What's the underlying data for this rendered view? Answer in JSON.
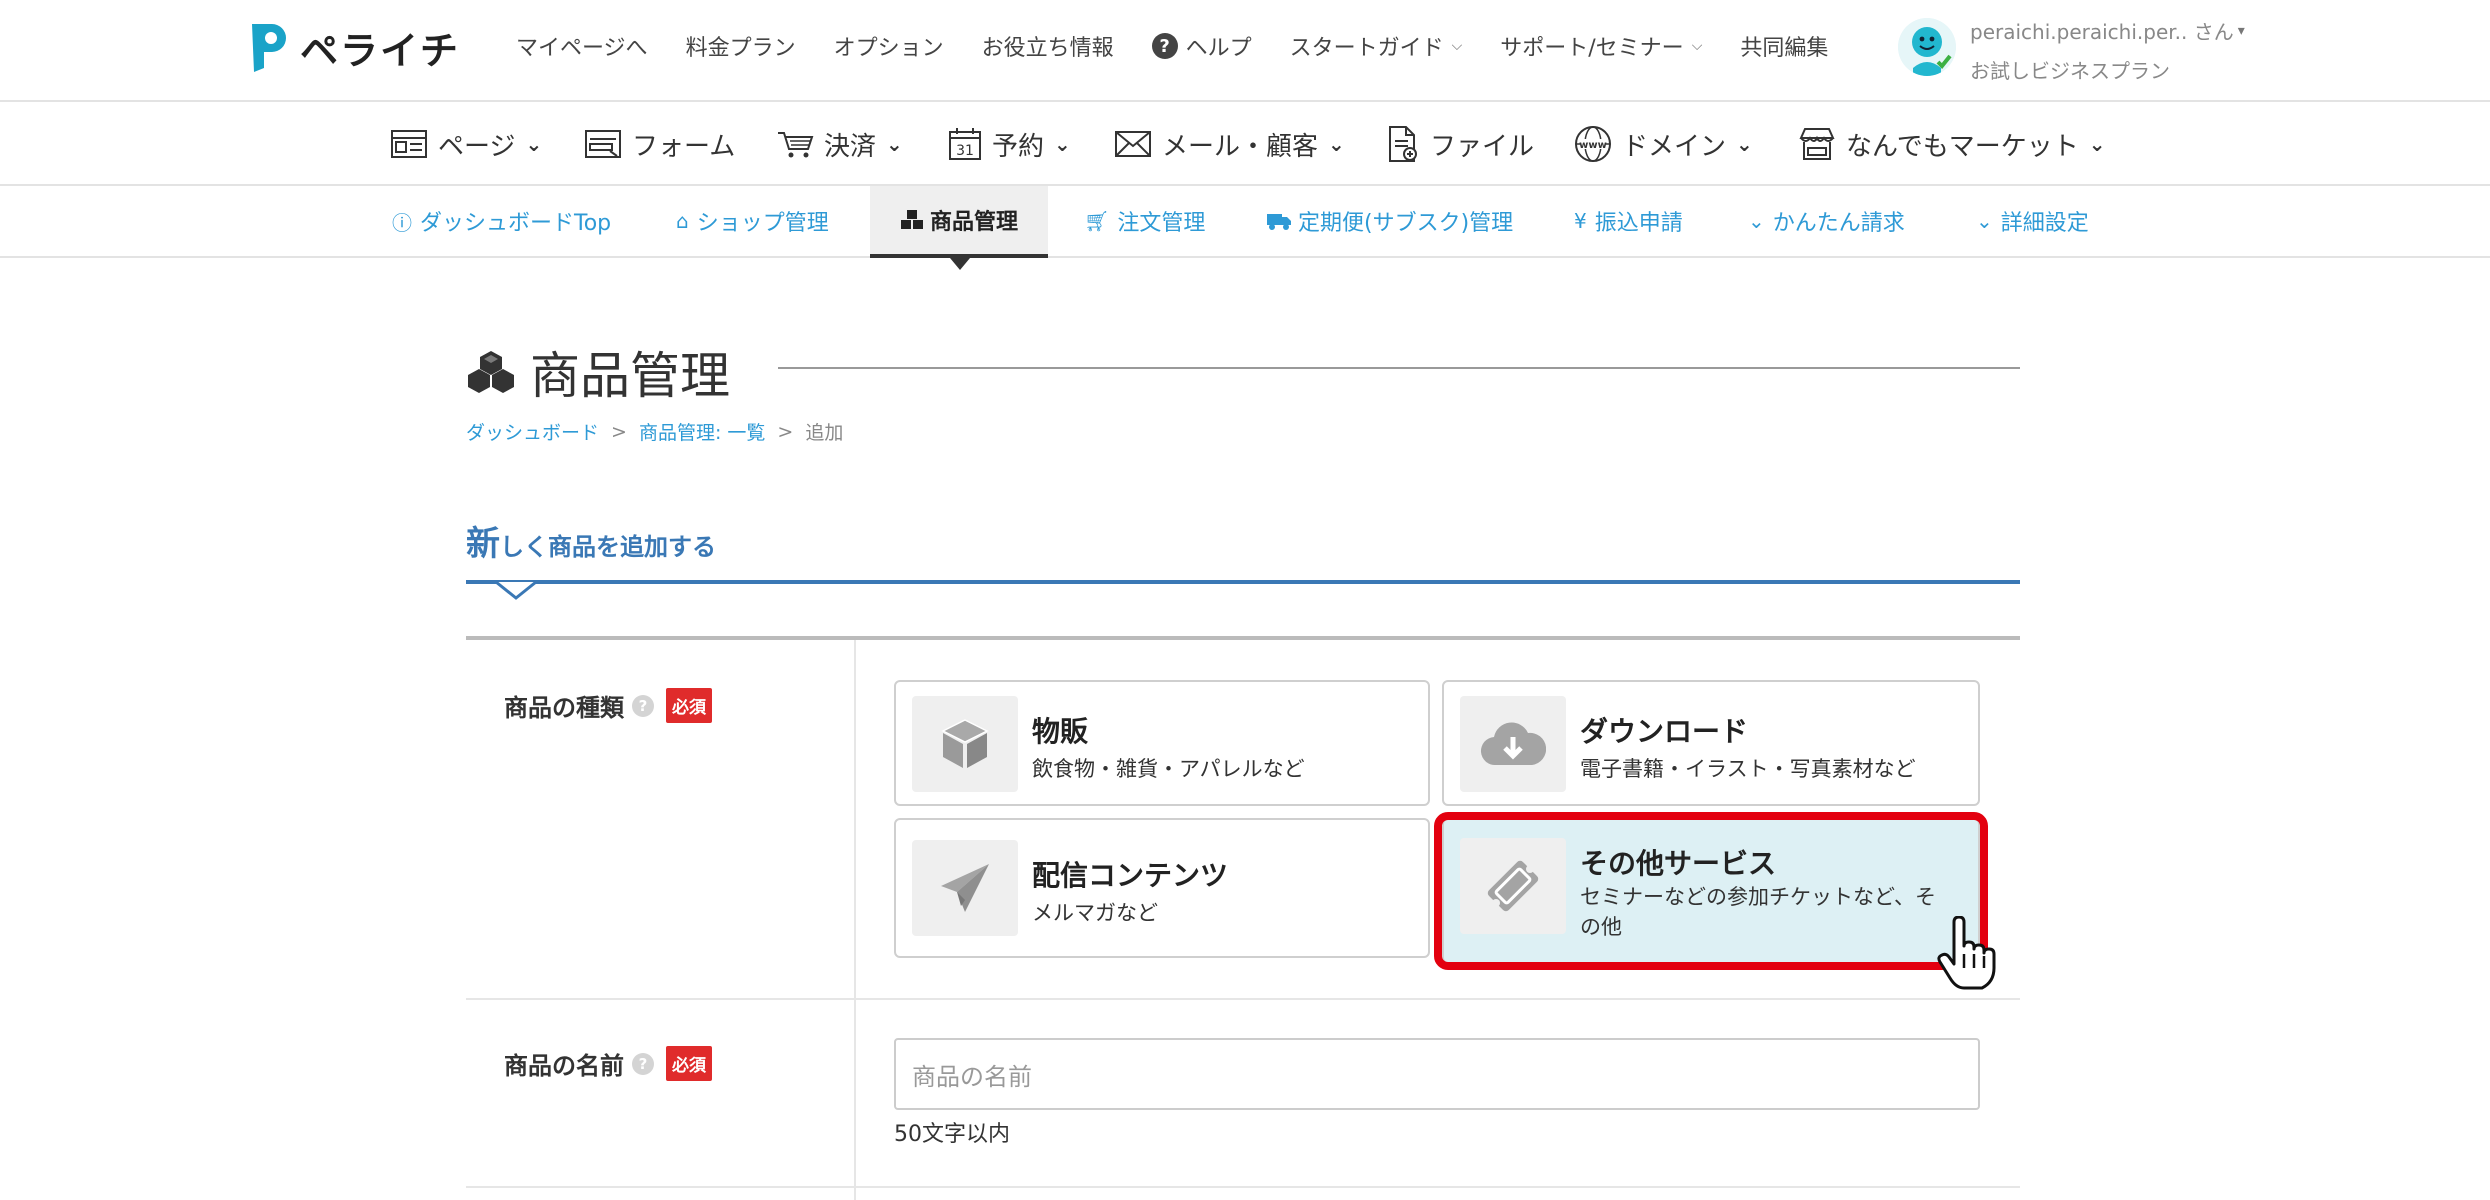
{
  "header": {
    "logo_text": "ペライチ",
    "nav": [
      {
        "label": "マイページへ"
      },
      {
        "label": "料金プラン"
      },
      {
        "label": "オプション"
      },
      {
        "label": "お役立ち情報"
      },
      {
        "label": "ヘルプ",
        "icon": "help-circle-icon"
      },
      {
        "label": "スタートガイド",
        "dropdown": true
      },
      {
        "label": "サポート/セミナー",
        "dropdown": true
      },
      {
        "label": "共同編集"
      }
    ],
    "user": {
      "name": "peraichi.peraichi.per.. さん",
      "plan": "お試しビジネスプラン",
      "icon": "avatar-icon"
    }
  },
  "main_nav": [
    {
      "label": "ページ",
      "icon": "page-icon"
    },
    {
      "label": "フォーム",
      "icon": "form-icon"
    },
    {
      "label": "決済",
      "icon": "cart-icon"
    },
    {
      "label": "予約",
      "icon": "calendar-icon",
      "calendar_day": "31"
    },
    {
      "label": "メール・顧客",
      "icon": "mail-icon"
    },
    {
      "label": "ファイル",
      "icon": "file-icon"
    },
    {
      "label": "ドメイン",
      "icon": "globe-icon",
      "globe_text": "www"
    },
    {
      "label": "なんでもマーケット",
      "icon": "market-icon"
    }
  ],
  "sub_nav": [
    {
      "label": "ダッシュボードTop",
      "icon": "info-icon"
    },
    {
      "label": "ショップ管理",
      "icon": "home-icon"
    },
    {
      "label": "商品管理",
      "icon": "cubes-icon",
      "active": true
    },
    {
      "label": "注文管理",
      "icon": "cart-icon"
    },
    {
      "label": "定期便(サブスク)管理",
      "icon": "truck-icon"
    },
    {
      "label": "振込申請",
      "icon": "yen-icon",
      "icon_glyph": "¥"
    },
    {
      "label": "かんたん請求",
      "icon": "chevron-down-icon"
    },
    {
      "label": "詳細設定",
      "icon": "chevron-down-icon"
    }
  ],
  "page": {
    "title": "商品管理",
    "breadcrumb": [
      "ダッシュボード",
      "商品管理: 一覧",
      "追加"
    ],
    "breadcrumb_separator": ">",
    "section": {
      "first_char": "新",
      "rest": "しく商品を追加する"
    }
  },
  "form": {
    "type_field": {
      "label": "商品の種類",
      "help": "?",
      "required": "必須",
      "options": [
        {
          "title": "物販",
          "desc": "飲食物・雑貨・アパレルなど",
          "icon": "box-icon"
        },
        {
          "title": "ダウンロード",
          "desc": "電子書籍・イラスト・写真素材など",
          "icon": "cloud-download-icon"
        },
        {
          "title": "配信コンテンツ",
          "desc": "メルマガなど",
          "icon": "paper-plane-icon"
        },
        {
          "title": "その他サービス",
          "desc_line1": "セミナーなどの参加チケットなど、そ",
          "desc_line2": "の他",
          "icon": "ticket-icon",
          "selected": true
        }
      ]
    },
    "name_field": {
      "label": "商品の名前",
      "help": "?",
      "required": "必須",
      "placeholder": "商品の名前",
      "hint": "50文字以内"
    }
  },
  "colors": {
    "accent_blue": "#2e9ad6",
    "section_blue": "#3a78b5",
    "required_red": "#e02b2b",
    "highlight_red": "#e3000f",
    "selected_bg": "#ddf0f4"
  }
}
